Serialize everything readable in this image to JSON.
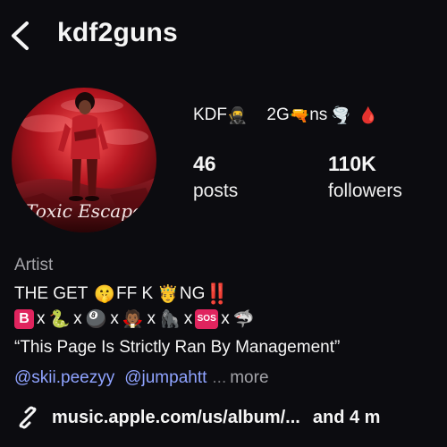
{
  "header": {
    "username": "kdf2guns"
  },
  "profile": {
    "display_name_parts": [
      "KDF",
      "🥷",
      "2G",
      "🔫",
      "ns",
      "🌪️",
      "🩸"
    ],
    "stats": [
      {
        "value": "46",
        "label": "posts"
      },
      {
        "value": "110K",
        "label": "followers"
      }
    ],
    "avatar_text": "Toxic Escape"
  },
  "bio": {
    "category": "Artist",
    "line1": {
      "a": "THE GET",
      "emoji1": "🤫",
      "b": "FF K",
      "emoji2": "🤴",
      "c": "NG",
      "d": "‼️"
    },
    "line2": {
      "b_box": "B",
      "x": "x",
      "snake": "🐍",
      "eight_ball": "🎱",
      "vampire": "🧛🏾",
      "gorilla": "🦍",
      "sos": "SOS",
      "shark": "🦈"
    },
    "quote": "“This Page Is Strictly Ran By Management”",
    "mentions": [
      "@skii.peezyy",
      "@jumpahtt"
    ],
    "ellipsis": "...",
    "more": "more"
  },
  "link": {
    "text": "music.apple.com/us/album/...",
    "extra": "and 4 m"
  },
  "colors": {
    "background": "#0c0c10",
    "mention": "#8fa3ff",
    "muted": "#a3a3a8"
  },
  "icons": [
    "back-chevron-icon",
    "link-chain-icon"
  ]
}
